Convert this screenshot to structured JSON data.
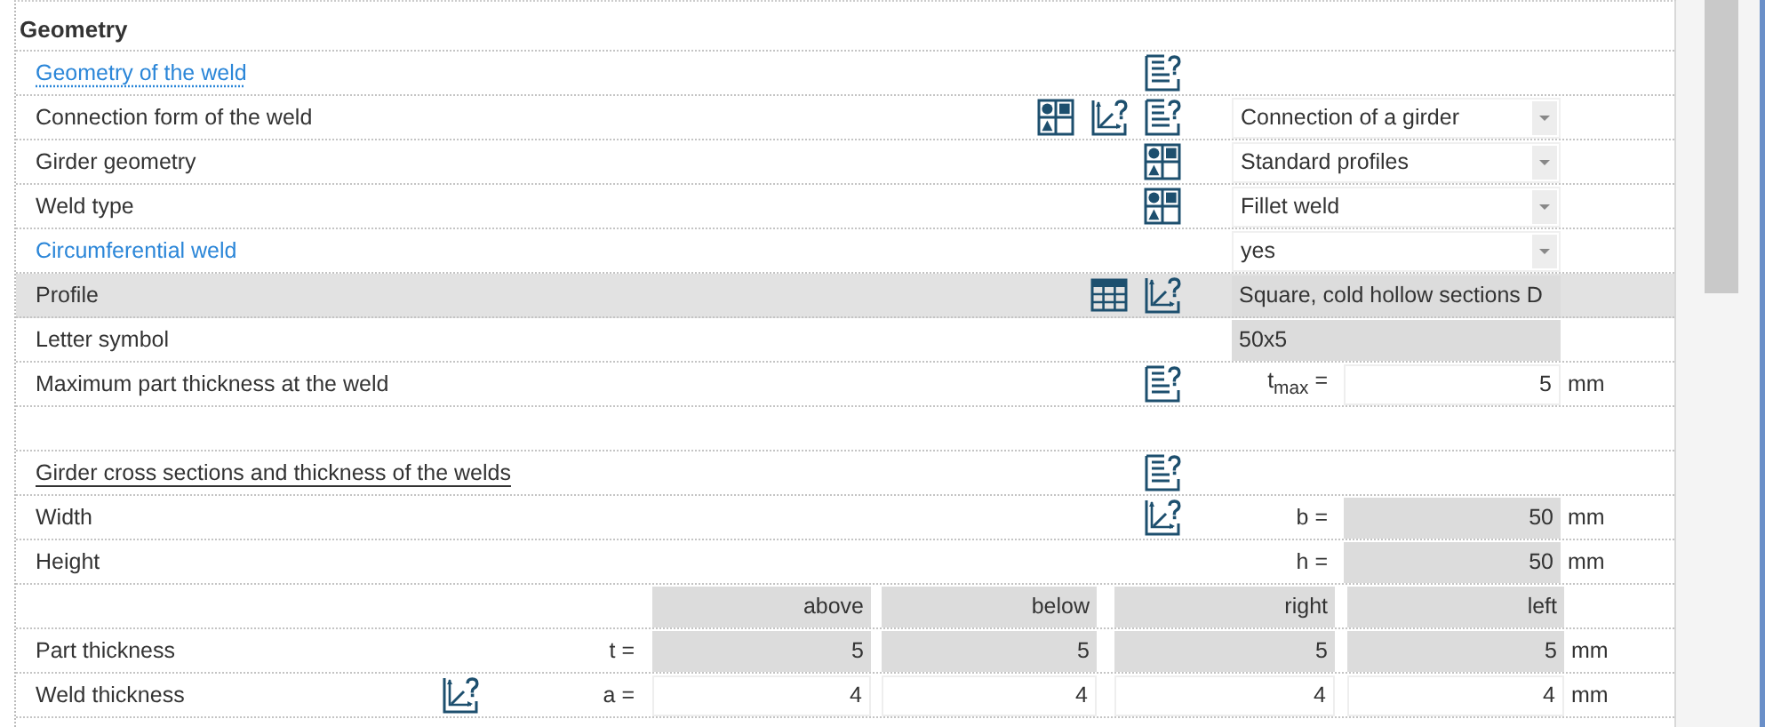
{
  "section": {
    "title": "Geometry"
  },
  "rows": [
    {
      "kind": "field",
      "label": "Geometry of the weld",
      "link": true,
      "underlined": true,
      "shaded": false,
      "icons": [
        {
          "kind": "info"
        }
      ]
    },
    {
      "kind": "field",
      "label": "Connection form of the weld",
      "link": false,
      "underlined": false,
      "shaded": false,
      "icons": [
        {
          "kind": "choice"
        },
        {
          "kind": "graphic"
        },
        {
          "kind": "info"
        }
      ],
      "value": {
        "kind": "dropdown",
        "text": "Connection of a girder"
      }
    },
    {
      "kind": "field",
      "label": "Girder geometry",
      "link": false,
      "underlined": false,
      "shaded": false,
      "icons": [
        {
          "kind": "choice"
        }
      ],
      "value": {
        "kind": "dropdown",
        "text": "Standard profiles"
      }
    },
    {
      "kind": "field",
      "label": "Weld type",
      "link": false,
      "underlined": false,
      "shaded": false,
      "icons": [
        {
          "kind": "choice"
        }
      ],
      "value": {
        "kind": "dropdown",
        "text": "Fillet weld"
      }
    },
    {
      "kind": "field",
      "label": "Circumferential weld",
      "link": true,
      "underlined": false,
      "shaded": false,
      "value": {
        "kind": "dropdown",
        "text": "yes"
      }
    },
    {
      "kind": "field",
      "label": "Profile",
      "link": false,
      "underlined": false,
      "shaded": true,
      "icons": [
        {
          "kind": "table"
        },
        {
          "kind": "graphic"
        }
      ],
      "value": {
        "kind": "readonly-wide",
        "text": "Square, cold hollow sections D"
      }
    },
    {
      "kind": "field",
      "label": "Letter symbol",
      "link": false,
      "underlined": false,
      "shaded": false,
      "value": {
        "kind": "readonly-wide",
        "text": "50x5"
      }
    },
    {
      "kind": "field",
      "label": "Maximum part thickness at the weld",
      "link": false,
      "underlined": false,
      "shaded": false,
      "icons": [
        {
          "kind": "info"
        }
      ],
      "symbol": "t$_{max}$ =",
      "value": {
        "kind": "input",
        "text": "5"
      },
      "unit": "mm"
    },
    {
      "kind": "blank"
    },
    {
      "kind": "field",
      "label": "Girder cross sections and thickness of the welds",
      "link": false,
      "underlined": true,
      "shaded": false,
      "icons": [
        {
          "kind": "info"
        }
      ]
    },
    {
      "kind": "field",
      "label": "Width",
      "link": false,
      "underlined": false,
      "shaded": false,
      "icons": [
        {
          "kind": "graphic"
        }
      ],
      "symbol": "b =",
      "value": {
        "kind": "readonly",
        "text": "50"
      },
      "unit": "mm"
    },
    {
      "kind": "field",
      "label": "Height",
      "link": false,
      "underlined": false,
      "shaded": false,
      "symbol": "h =",
      "value": {
        "kind": "readonly",
        "text": "50"
      },
      "unit": "mm"
    },
    {
      "kind": "table-header",
      "cells": [
        "above",
        "below",
        "right",
        "left"
      ]
    },
    {
      "kind": "table-row",
      "label": "Part thickness",
      "symbol": "t =",
      "cells": [
        "5",
        "5",
        "5",
        "5"
      ],
      "editable": false,
      "unit": "mm"
    },
    {
      "kind": "table-row",
      "label": "Weld thickness",
      "icons": [
        {
          "kind": "graphic"
        }
      ],
      "symbol": "a =",
      "cells": [
        "4",
        "4",
        "4",
        "4"
      ],
      "editable": true,
      "unit": "mm"
    }
  ]
}
